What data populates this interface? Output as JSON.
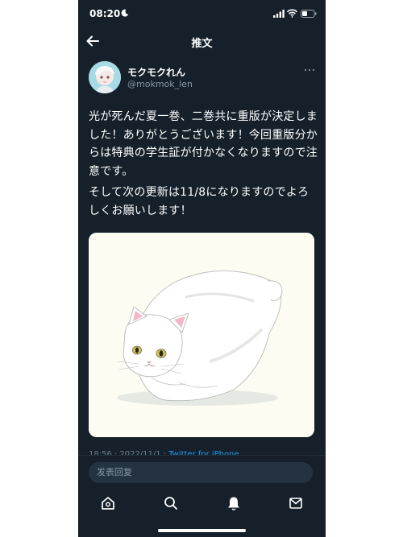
{
  "status_bar": {
    "time": "08:20",
    "icons": [
      "moon-icon",
      "signal-icon",
      "wifi-icon",
      "battery-icon"
    ]
  },
  "header": {
    "title": "推文",
    "back_icon": "arrow-left-icon"
  },
  "tweet": {
    "author": {
      "display_name": "モクモクれん",
      "handle": "@mokmok_len"
    },
    "more_icon": "more-horizontal-icon",
    "text_paragraphs": [
      "光が死んだ夏一巻、二巻共に重版が決定しました！ありがとうございます！今回重版分からは特典の学生証が付かなくなりますので注意です。",
      "そして次の更新は11/8になりますのでよろしくお願いします！"
    ],
    "image": "white-cat-illustration",
    "meta": {
      "timestamp": "18:56 · 2022/11/1 · ",
      "source": "Twitter for iPhone"
    }
  },
  "reply_bar": {
    "placeholder": "发表回复"
  },
  "tab_bar": {
    "tabs": [
      {
        "icon": "home-icon",
        "active": true
      },
      {
        "icon": "search-icon",
        "active": false
      },
      {
        "icon": "bell-icon",
        "active": false
      },
      {
        "icon": "mail-icon",
        "active": false
      }
    ]
  },
  "colors": {
    "background": "#15202b",
    "text": "#ffffff",
    "secondary_text": "#8899a6",
    "accent": "#1d9bf0"
  }
}
